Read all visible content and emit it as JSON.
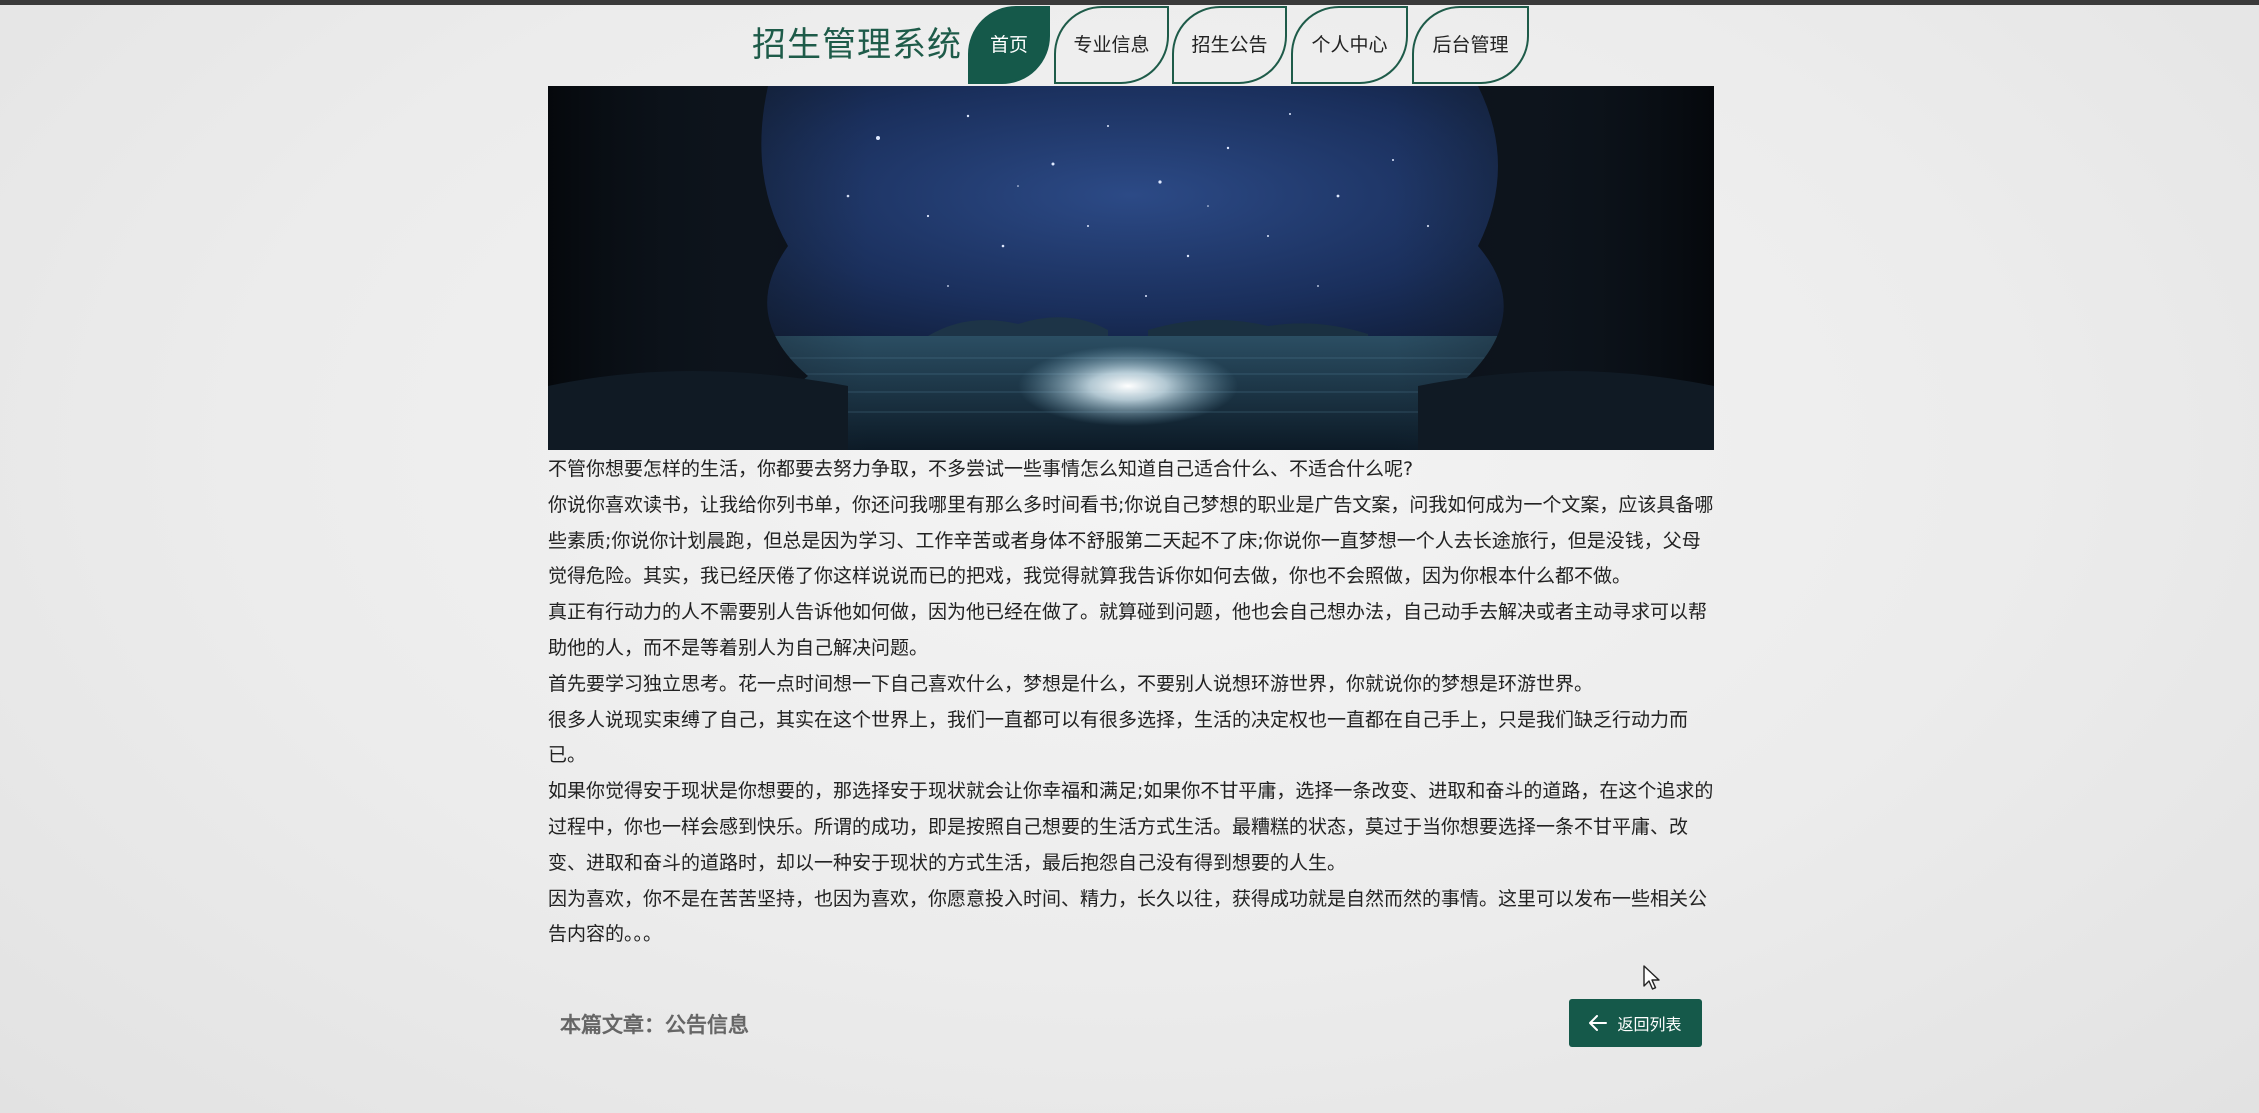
{
  "header": {
    "site_title": "招生管理系统",
    "nav": [
      {
        "label": "首页",
        "active": true
      },
      {
        "label": "专业信息",
        "active": false
      },
      {
        "label": "招生公告",
        "active": false
      },
      {
        "label": "个人中心",
        "active": false
      },
      {
        "label": "后台管理",
        "active": false
      }
    ]
  },
  "article": {
    "paragraphs": [
      "不管你想要怎样的生活，你都要去努力争取，不多尝试一些事情怎么知道自己适合什么、不适合什么呢?",
      "你说你喜欢读书，让我给你列书单，你还问我哪里有那么多时间看书;你说自己梦想的职业是广告文案，问我如何成为一个文案，应该具备哪些素质;你说你计划晨跑，但总是因为学习、工作辛苦或者身体不舒服第二天起不了床;你说你一直梦想一个人去长途旅行，但是没钱，父母觉得危险。其实，我已经厌倦了你这样说说而已的把戏，我觉得就算我告诉你如何去做，你也不会照做，因为你根本什么都不做。",
      "真正有行动力的人不需要别人告诉他如何做，因为他已经在做了。就算碰到问题，他也会自己想办法，自己动手去解决或者主动寻求可以帮助他的人，而不是等着别人为自己解决问题。",
      "首先要学习独立思考。花一点时间想一下自己喜欢什么，梦想是什么，不要别人说想环游世界，你就说你的梦想是环游世界。",
      "很多人说现实束缚了自己，其实在这个世界上，我们一直都可以有很多选择，生活的决定权也一直都在自己手上，只是我们缺乏行动力而已。",
      "如果你觉得安于现状是你想要的，那选择安于现状就会让你幸福和满足;如果你不甘平庸，选择一条改变、进取和奋斗的道路，在这个追求的过程中，你也一样会感到快乐。所谓的成功，即是按照自己想要的生活方式生活。最糟糕的状态，莫过于当你想要选择一条不甘平庸、改变、进取和奋斗的道路时，却以一种安于现状的方式生活，最后抱怨自己没有得到想要的人生。",
      "因为喜欢，你不是在苦苦坚持，也因为喜欢，你愿意投入时间、精力，长久以往，获得成功就是自然而然的事情。这里可以发布一些相关公告内容的。。。"
    ]
  },
  "footer": {
    "article_label": "本篇文章：公告信息",
    "back_button_label": "返回列表"
  },
  "icons": {
    "back": "arrow-left-icon",
    "cursor": "mouse-pointer-icon"
  },
  "colors": {
    "accent": "#15594a",
    "title": "#1e5b49"
  }
}
